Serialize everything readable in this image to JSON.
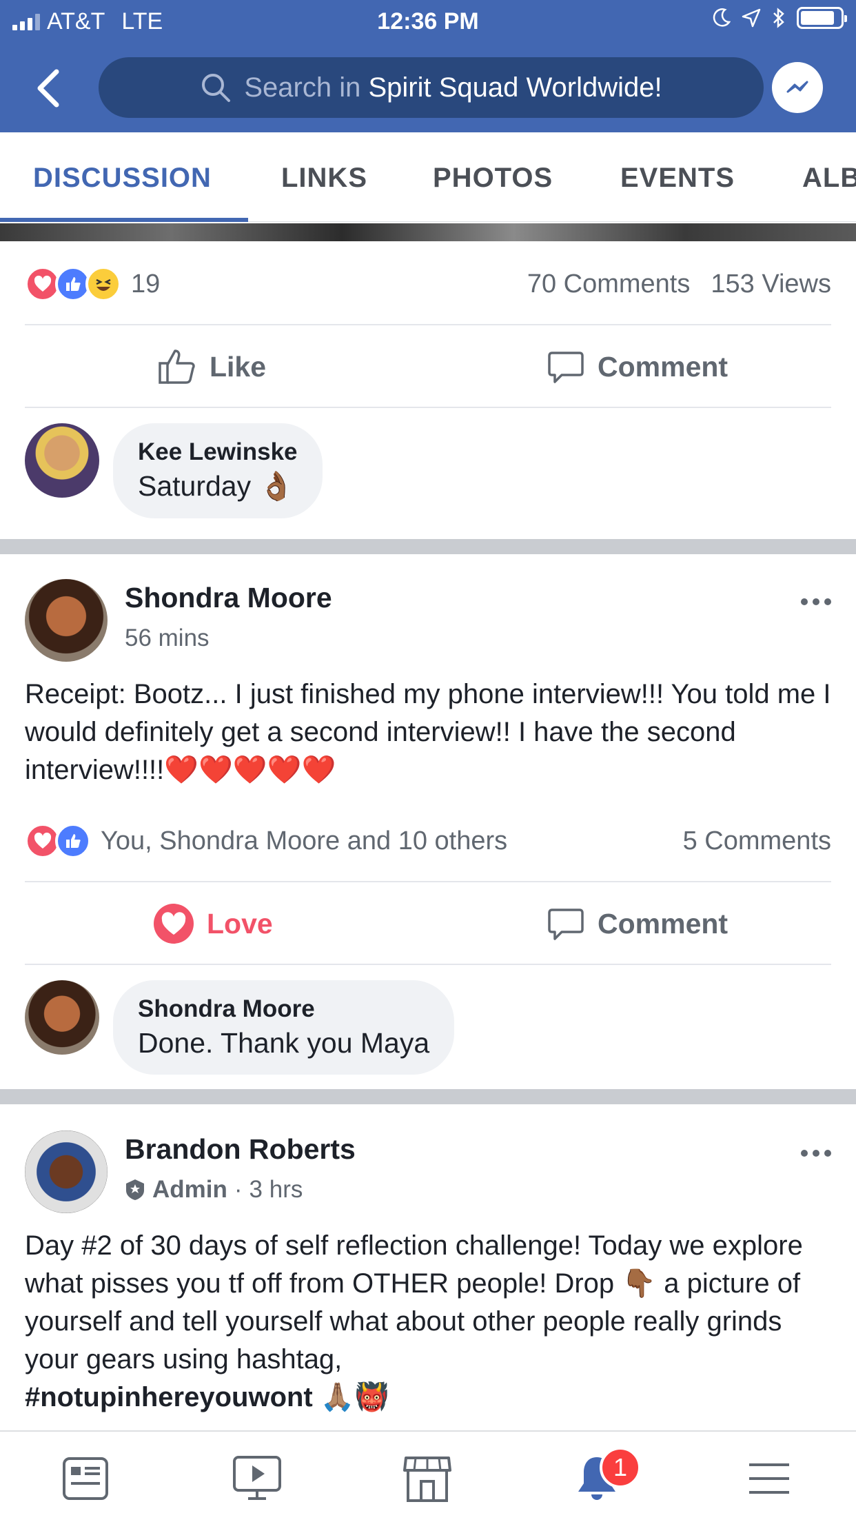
{
  "status_bar": {
    "carrier": "AT&T",
    "network": "LTE",
    "time": "12:36 PM"
  },
  "header": {
    "search_placeholder": "Search in",
    "group_name": "Spirit Squad Worldwide!"
  },
  "tabs": [
    "DISCUSSION",
    "LINKS",
    "PHOTOS",
    "EVENTS",
    "ALB"
  ],
  "post1": {
    "reaction_count": "19",
    "comments": "70 Comments",
    "views": "153 Views",
    "like_label": "Like",
    "comment_label": "Comment",
    "comment": {
      "author": "Kee Lewinske",
      "text": "Saturday 👌🏾"
    }
  },
  "post2": {
    "author": "Shondra Moore",
    "time": "56 mins",
    "text": "Receipt: Bootz... I just finished my phone interview!!! You told me I would definitely get a second interview!! I have the second interview!!!!❤️❤️❤️❤️❤️",
    "reactions_text": "You, Shondra Moore and 10 others",
    "comments": "5 Comments",
    "love_label": "Love",
    "comment_label": "Comment",
    "comment": {
      "author": "Shondra Moore",
      "text": "Done. Thank you Maya"
    }
  },
  "post3": {
    "author": "Brandon Roberts",
    "role": "Admin",
    "separator": "·",
    "time": "3 hrs",
    "text": "Day #2 of 30 days of self reflection challenge! Today we explore what pisses you tf off from OTHER people! Drop 👇🏾 a picture of yourself and tell yourself what about other people really grinds your gears using hashtag,",
    "hashtag": "#notupinhereyouwont",
    "trailing_emoji": "🙏🏽👹"
  },
  "bottom_nav": {
    "items": [
      "news-feed",
      "watch",
      "marketplace",
      "notifications",
      "menu"
    ],
    "notification_count": "1"
  },
  "colors": {
    "brand": "#4267b2",
    "love": "#f25268",
    "like": "#4d7cfe",
    "badge": "#fa3e3e"
  }
}
